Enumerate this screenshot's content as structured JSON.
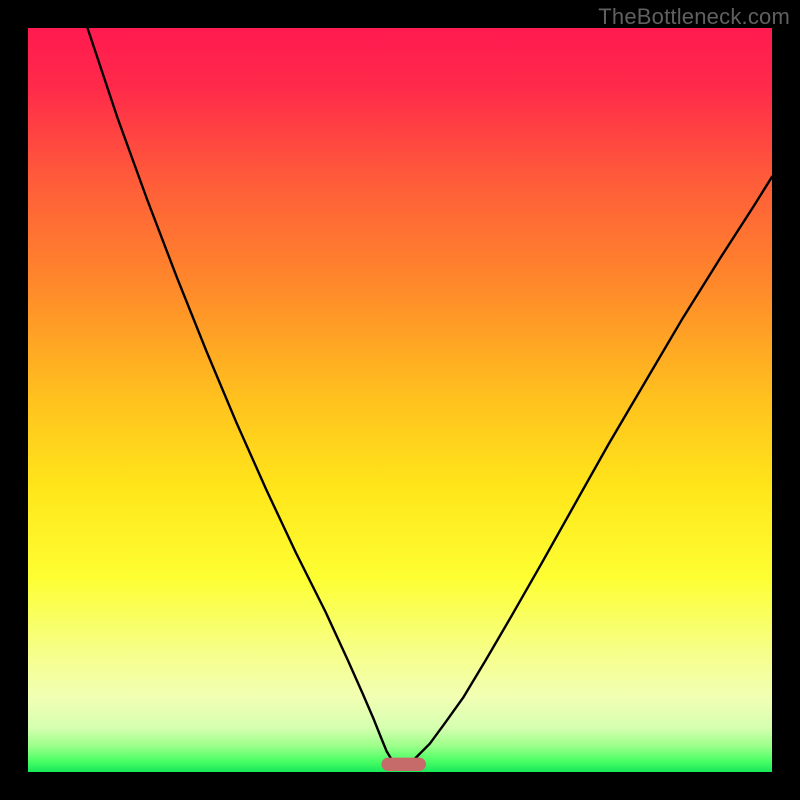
{
  "watermark": "TheBottleneck.com",
  "chart_data": {
    "type": "line",
    "title": "",
    "xlabel": "",
    "ylabel": "",
    "xlim": [
      0,
      1
    ],
    "ylim": [
      0,
      1
    ],
    "background_gradient": {
      "stops": [
        {
          "offset": 0.0,
          "color": "#ff1a50"
        },
        {
          "offset": 0.08,
          "color": "#ff2a4a"
        },
        {
          "offset": 0.2,
          "color": "#ff5a3a"
        },
        {
          "offset": 0.35,
          "color": "#ff8a2a"
        },
        {
          "offset": 0.5,
          "color": "#ffc21e"
        },
        {
          "offset": 0.62,
          "color": "#ffe61a"
        },
        {
          "offset": 0.74,
          "color": "#fdff33"
        },
        {
          "offset": 0.84,
          "color": "#f6ff8a"
        },
        {
          "offset": 0.9,
          "color": "#f1ffb4"
        },
        {
          "offset": 0.94,
          "color": "#d6ffb0"
        },
        {
          "offset": 0.965,
          "color": "#9cff8a"
        },
        {
          "offset": 0.985,
          "color": "#4bff66"
        },
        {
          "offset": 1.0,
          "color": "#18e85a"
        }
      ]
    },
    "series": [
      {
        "name": "left-curve",
        "x": [
          0.08,
          0.12,
          0.16,
          0.2,
          0.24,
          0.28,
          0.32,
          0.36,
          0.4,
          0.43,
          0.45,
          0.465,
          0.475,
          0.482,
          0.488
        ],
        "y": [
          1.0,
          0.88,
          0.77,
          0.665,
          0.565,
          0.47,
          0.38,
          0.295,
          0.215,
          0.15,
          0.105,
          0.07,
          0.045,
          0.028,
          0.018
        ]
      },
      {
        "name": "right-curve",
        "x": [
          0.52,
          0.54,
          0.56,
          0.585,
          0.615,
          0.65,
          0.69,
          0.735,
          0.78,
          0.83,
          0.88,
          0.93,
          0.975,
          1.0
        ],
        "y": [
          0.018,
          0.038,
          0.065,
          0.1,
          0.15,
          0.21,
          0.28,
          0.36,
          0.44,
          0.525,
          0.61,
          0.69,
          0.76,
          0.8
        ]
      }
    ],
    "marker": {
      "name": "bottom-marker",
      "x_center": 0.505,
      "width": 0.06,
      "height": 0.018,
      "color": "#c76a6a"
    }
  }
}
